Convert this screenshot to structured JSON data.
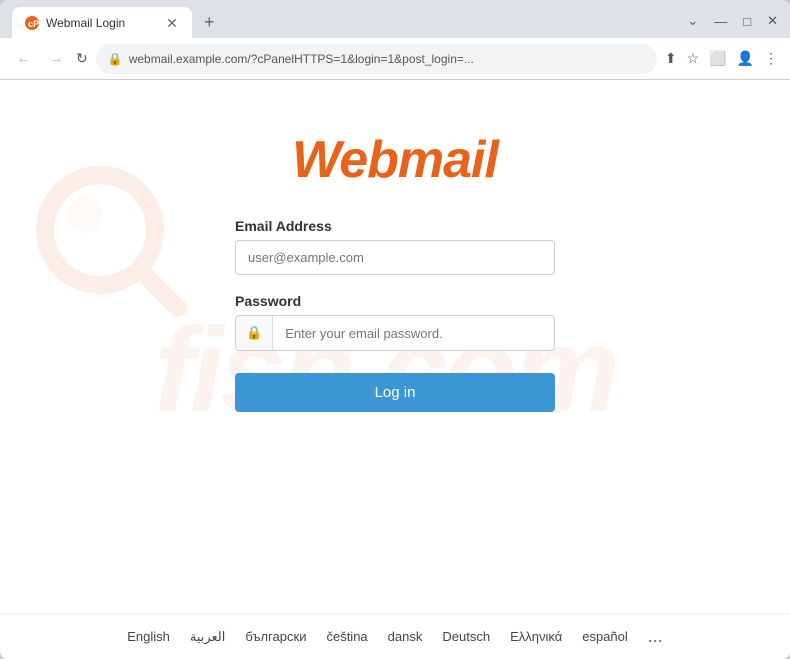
{
  "browser": {
    "tab_title": "Webmail Login",
    "url": "https://webmail.example.com/?cPanelHTTPS=1&login=1&post_login=...",
    "url_display": "webmail.example.com/?cPanelHTTPS=1&login=1&post_login=...",
    "new_tab_label": "+",
    "back_btn": "←",
    "forward_btn": "→",
    "reload_btn": "↻",
    "window_controls": {
      "minimize": "—",
      "maximize": "□",
      "close": "✕"
    }
  },
  "page": {
    "logo_text": "Webmail",
    "watermark_text": "fish.com",
    "form": {
      "email_label": "Email Address",
      "email_placeholder": "user@example.com",
      "password_label": "Password",
      "password_placeholder": "Enter your email password.",
      "login_button": "Log in"
    },
    "languages": [
      "English",
      "العربية",
      "български",
      "čeština",
      "dansk",
      "Deutsch",
      "Ελληνικά",
      "español",
      "..."
    ]
  }
}
